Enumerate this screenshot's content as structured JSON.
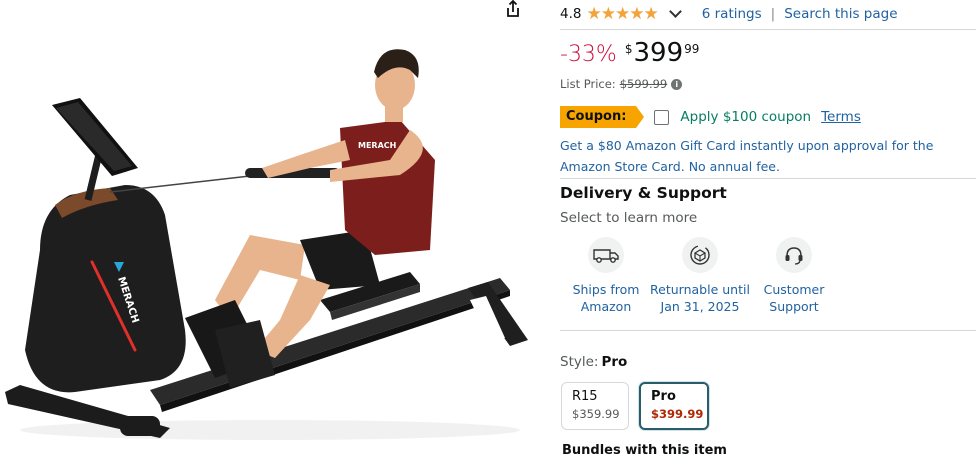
{
  "rating": {
    "value": "4.8",
    "stars": 4.8,
    "star_glyphs": [
      "★",
      "★",
      "★",
      "★",
      "★"
    ],
    "ratings_link": "6 ratings",
    "separator": "|",
    "search_link": "Search this page"
  },
  "price": {
    "discount": "-33%",
    "symbol": "$",
    "whole": "399",
    "fraction": "99",
    "list_label": "List Price:",
    "list_value": "$599.99"
  },
  "coupon": {
    "badge": "Coupon:",
    "text": "Apply $100 coupon",
    "terms": "Terms"
  },
  "gift_card": "Get a $80 Amazon Gift Card instantly upon approval for the Amazon Store Card. No annual fee.",
  "delivery": {
    "title": "Delivery & Support",
    "subtitle": "Select to learn more",
    "items": [
      {
        "label": "Ships from Amazon",
        "icon": "truck-icon"
      },
      {
        "label": "Returnable until Jan 31, 2025",
        "icon": "return-box-icon"
      },
      {
        "label": "Customer Support",
        "icon": "headset-icon"
      }
    ]
  },
  "style": {
    "label": "Style:",
    "selected": "Pro",
    "options": [
      {
        "name": "R15",
        "price": "$359.99",
        "selected": false
      },
      {
        "name": "Pro",
        "price": "$399.99",
        "selected": true
      }
    ]
  },
  "bundles_title": "Bundles with this item",
  "product_image": {
    "brand_text": "MERACH",
    "shirt_text": "MERACH"
  },
  "colors": {
    "link": "#2162a1",
    "discount": "#cc0c39",
    "coupon_badge": "#f7a300",
    "coupon_text": "#067d62",
    "selected_border": "#2a5d6a",
    "selected_price": "#b12704",
    "star": "#f2a33a"
  }
}
